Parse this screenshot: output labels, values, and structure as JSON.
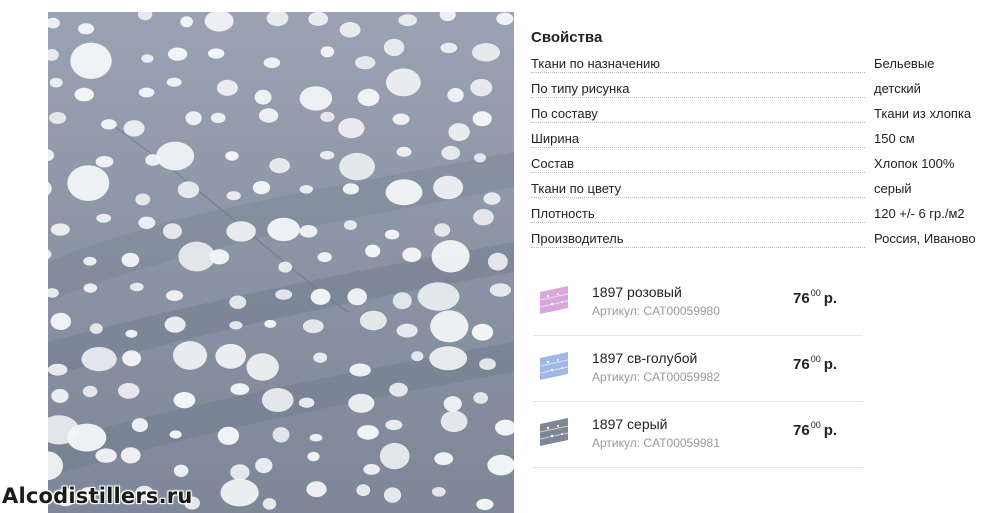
{
  "properties": {
    "title": "Свойства",
    "rows": [
      {
        "name": "Ткани по назначению",
        "value": "Бельевые"
      },
      {
        "name": "По типу рисунка",
        "value": "детский"
      },
      {
        "name": "По составу",
        "value": "Ткани из хлопка"
      },
      {
        "name": "Ширина",
        "value": "150 см"
      },
      {
        "name": "Состав",
        "value": "Хлопок 100%"
      },
      {
        "name": "Ткани по цвету",
        "value": "серый"
      },
      {
        "name": "Плотность",
        "value": "120 +/- 6 гр./м2"
      },
      {
        "name": "Производитель",
        "value": "Россия, Иваново"
      }
    ]
  },
  "variants": [
    {
      "name": "1897 розовый",
      "sku": "Артикул: CAT00059980",
      "price_int": "76",
      "price_dec": "00",
      "currency": "р.",
      "swatch_color": "#d9a7dd"
    },
    {
      "name": "1897 св-голубой",
      "sku": "Артикул: CAT00059982",
      "price_int": "76",
      "price_dec": "00",
      "currency": "р.",
      "swatch_color": "#9fb9e6"
    },
    {
      "name": "1897 серый",
      "sku": "Артикул: CAT00059981",
      "price_int": "76",
      "price_dec": "00",
      "currency": "р.",
      "swatch_color": "#7f8796"
    }
  ],
  "watermark": "Alcodistillers.ru",
  "colors": {
    "fabric": "#8d97a8",
    "dot": "#f4f5f7"
  }
}
